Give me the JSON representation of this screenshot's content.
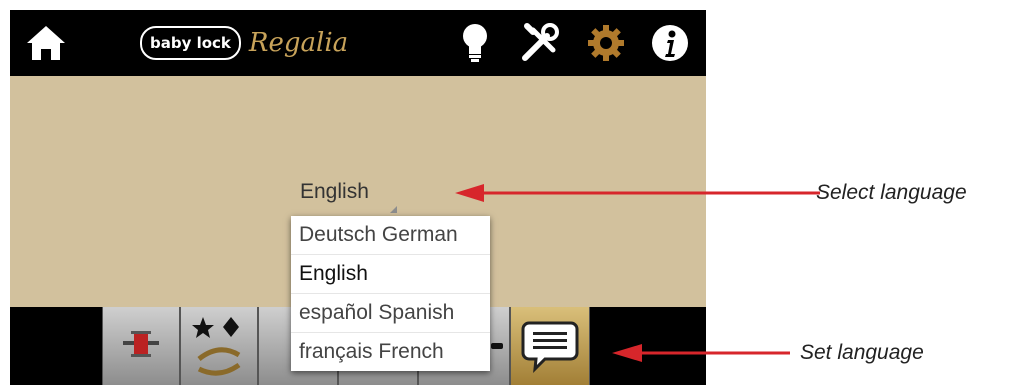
{
  "brand": {
    "badge": "baby lock",
    "model": "Regalia"
  },
  "topbar_icons": [
    "home-icon",
    "lightbulb-icon",
    "tools-icon",
    "gear-icon",
    "info-icon"
  ],
  "language": {
    "selected": "English",
    "options": [
      {
        "label": "Deutsch  German"
      },
      {
        "label": "English"
      },
      {
        "label": "español  Spanish"
      },
      {
        "label": "français  French"
      }
    ]
  },
  "bottombar_icons": [
    "bobbin-icon",
    "shapes-swap-icon",
    "bar-icon-3",
    "bar-icon-4",
    "bar-icon-5",
    "message-icon"
  ],
  "callouts": {
    "select": "Select language",
    "set": "Set language"
  },
  "colors": {
    "screen_bg": "#d2c19d",
    "bar_bg": "#000000",
    "accent_gold": "#c8a35a",
    "arrow_red": "#d7262b"
  }
}
